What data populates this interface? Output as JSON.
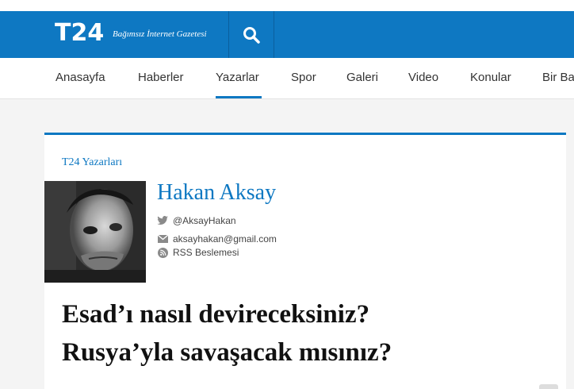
{
  "header": {
    "logo": "T24",
    "tagline": "Bağımsız İnternet Gazetesi",
    "search_icon": "search-icon",
    "brand_color": "#0e78c2"
  },
  "nav": {
    "items": [
      "Anasayfa",
      "Haberler",
      "Yazarlar",
      "Spor",
      "Galeri",
      "Video",
      "Konular",
      "Bir Ba"
    ],
    "active": "Yazarlar"
  },
  "article": {
    "section": "T24 Yazarları",
    "author": {
      "name": "Hakan Aksay",
      "twitter": "@AksayHakan",
      "email": "aksayhakan@gmail.com",
      "rss": "RSS Beslemesi"
    },
    "headline_line1": "Esad’ı nasıl devireceksiniz?",
    "headline_line2": "Rusya’yla savaşacak mısınız?"
  }
}
